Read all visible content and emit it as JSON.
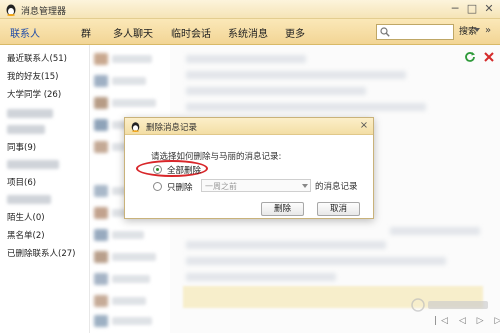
{
  "window": {
    "title": "消息管理器",
    "minimize": "─",
    "maximize": "□",
    "close": "✕"
  },
  "menu": {
    "tabs": [
      "联系人",
      "群",
      "多人聊天",
      "临时会话",
      "系统消息",
      "更多"
    ],
    "search_button": "搜索",
    "more": "»"
  },
  "sidebar": {
    "items": [
      "最近联系人(51)",
      "我的好友(15)",
      "大学同学 (26)",
      "同事(9)",
      "项目(6)",
      "陌生人(0)",
      "黑名单(2)",
      "已删除联系人(27)"
    ]
  },
  "dialog": {
    "title": "删除消息记录",
    "close": "×",
    "prompt": "请选择如何删除与马丽的消息记录:",
    "option_all": "全部删除",
    "option_partial": "只删除",
    "range_selected": "一周之前",
    "suffix": "的消息记录",
    "delete_button": "删除",
    "cancel_button": "取消"
  },
  "pager": "|◁ ◁ ▷ ▷|",
  "colors": {
    "accent_green": "#2d8a2d",
    "highlight_red": "#d8262a",
    "tab_active": "#1f4ba8"
  },
  "icons": [
    "penguin-logo-icon",
    "search-icon",
    "refresh-icon",
    "close-red-icon",
    "radio-icon",
    "chevron-down-icon"
  ]
}
